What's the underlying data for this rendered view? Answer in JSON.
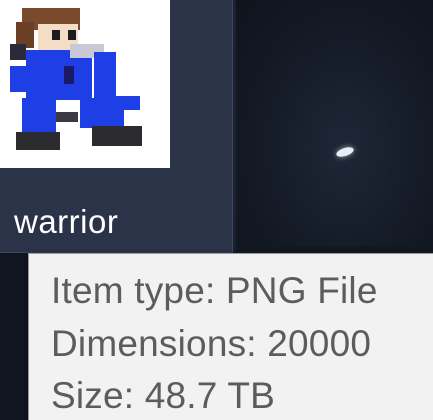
{
  "files": [
    {
      "name": "warrior",
      "thumbnail_icon": "warrior-sprite-icon"
    },
    {
      "name": "",
      "thumbnail_icon": "space-image-icon"
    }
  ],
  "tooltip": {
    "item_type": "Item type: PNG File",
    "dimensions": "Dimensions: 20000",
    "size": "Size: 48.7 TB"
  },
  "colors": {
    "tile_background": "#2a3347",
    "tooltip_background": "#f2f2f2",
    "tooltip_text": "#5c5c5c",
    "sprite_blue": "#1f3fe6",
    "sprite_hair": "#7a4a2c"
  }
}
